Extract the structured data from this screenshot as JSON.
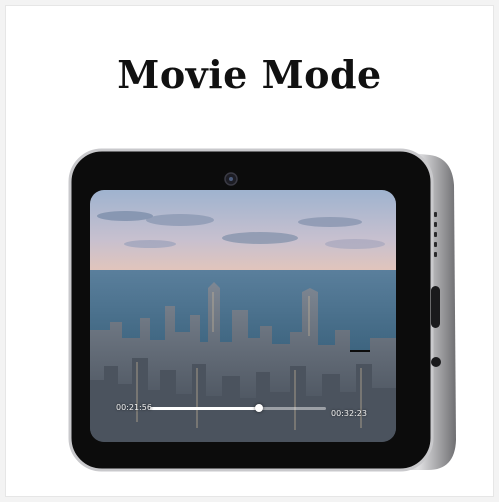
{
  "page": {
    "title": "Movie Mode"
  },
  "player": {
    "current_time": "00:21:56",
    "total_time": "00:32:23",
    "progress": 0.62
  },
  "icons": {
    "camera": "front-camera-icon",
    "speaker": "speaker-grille-icon",
    "port": "usb-c-port-icon",
    "button": "side-button-icon"
  },
  "colors": {
    "bezel": "#0c0c0c",
    "frame_metal": "#d8d8da",
    "sky_top": "#9fb3cf",
    "sky_bottom": "#e9c6b6",
    "water": "#4a7391"
  }
}
